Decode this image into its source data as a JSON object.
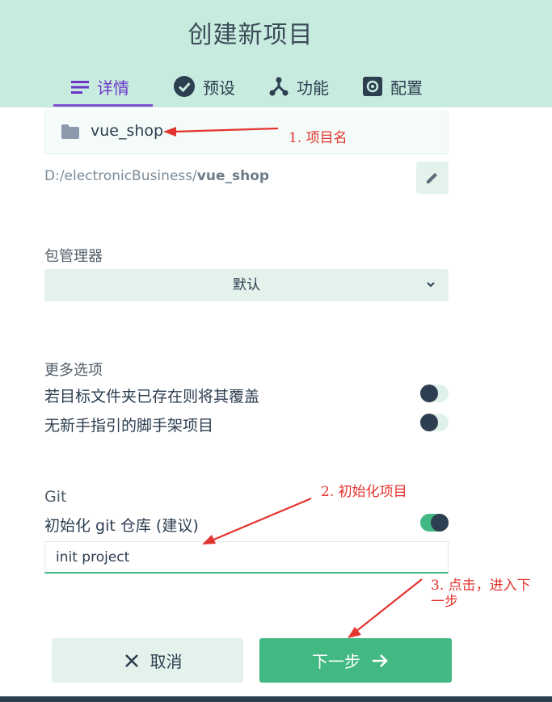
{
  "header": {
    "title": "创建新项目",
    "tabs": [
      {
        "label": "详情",
        "icon": "list-icon",
        "active": true
      },
      {
        "label": "预设",
        "icon": "check-circle-icon",
        "active": false
      },
      {
        "label": "功能",
        "icon": "branch-icon",
        "active": false
      },
      {
        "label": "配置",
        "icon": "gear-icon",
        "active": false
      }
    ]
  },
  "project": {
    "name": "vue_shop",
    "path_prefix": "D:/electronicBusiness/",
    "path_name": "vue_shop"
  },
  "package_manager": {
    "label": "包管理器",
    "selected": "默认"
  },
  "more_options": {
    "label": "更多选项",
    "options": [
      {
        "label": "若目标文件夹已存在则将其覆盖",
        "on": false
      },
      {
        "label": "无新手指引的脚手架项目",
        "on": false
      }
    ]
  },
  "git": {
    "label": "Git",
    "init_label": "初始化 git 仓库 (建议)",
    "init_on": true,
    "commit_message": "init project"
  },
  "footer": {
    "cancel_label": "取消",
    "next_label": "下一步"
  },
  "annotations": {
    "a1": "1. 项目名",
    "a2": "2. 初始化项目",
    "a3_line1": "3. 点击，进入下",
    "a3_line2": "一步"
  },
  "colors": {
    "header_bg": "#c8ebdf",
    "accent_green": "#42b983",
    "active_tab": "#6a35c7",
    "annotation_red": "#e3342f"
  }
}
